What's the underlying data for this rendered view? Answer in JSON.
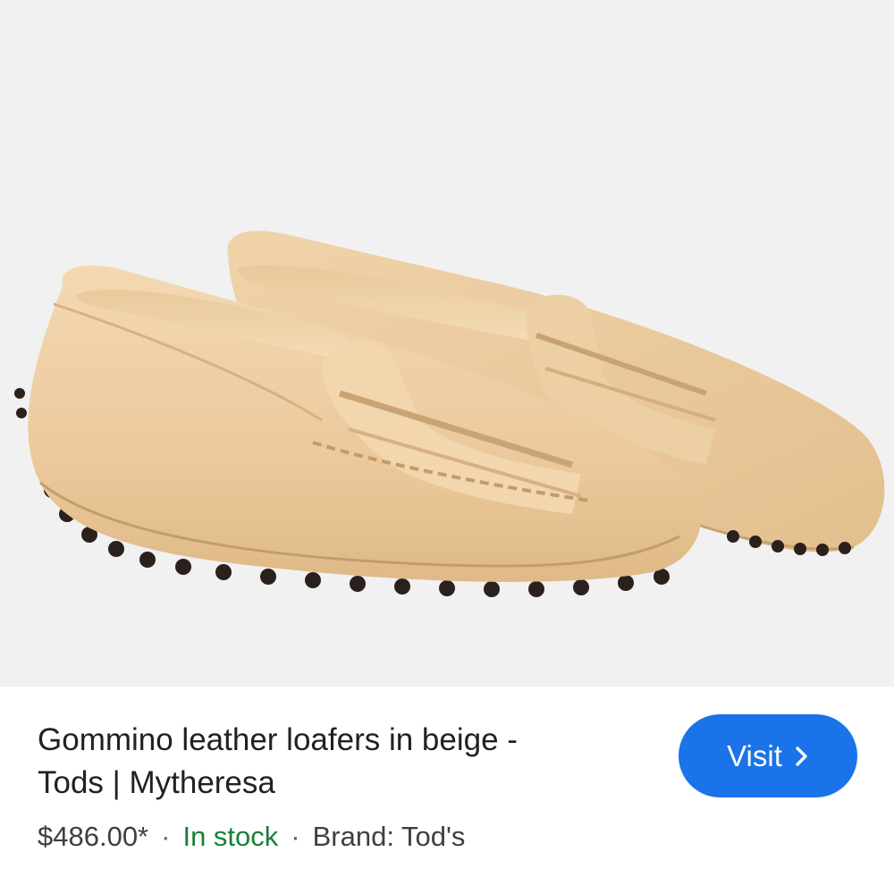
{
  "product": {
    "image_alt": "Gommino leather loafers in beige",
    "title_line1": "Gommino leather loafers in beige -",
    "title_line2": "Tods | Mytheresa",
    "price": "$486.00*",
    "separator": "·",
    "stock_status": "In stock",
    "brand": "Brand: Tod's"
  },
  "actions": {
    "visit_label": "Visit",
    "visit_icon": "chevron-right-icon"
  },
  "colors": {
    "accent": "#1a73e8",
    "stock": "#188038",
    "text": "#202124",
    "image_background": "#f1f1f1"
  }
}
